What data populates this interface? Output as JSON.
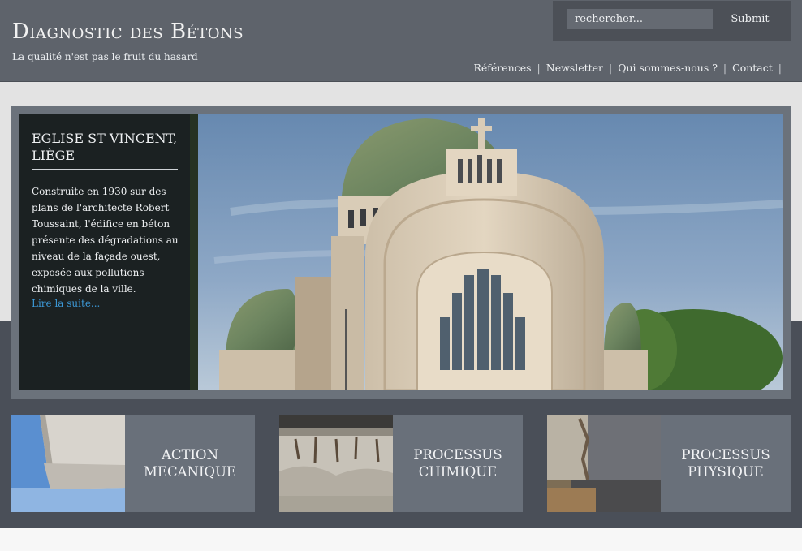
{
  "header": {
    "site_title": "Diagnostic des Bétons",
    "tagline": "La qualité n'est pas le fruit du hasard"
  },
  "search": {
    "placeholder": "rechercher...",
    "submit_label": "Submit"
  },
  "nav": {
    "items": [
      {
        "label": "Références"
      },
      {
        "label": "Newsletter"
      },
      {
        "label": "Qui sommes-nous ?"
      },
      {
        "label": "Contact"
      }
    ],
    "separator": "|"
  },
  "slider": {
    "title": "EGLISE ST VINCENT, LIÈGE",
    "text": "Construite en 1930 sur des plans de l'architecte Robert Toussaint, l'édifice en béton présente des dégradations au niveau de la façade ouest, exposée aux pollutions chimiques de la ville.",
    "link": "Lire la suite..."
  },
  "features": [
    {
      "label": "ACTION MECANIQUE"
    },
    {
      "label": "PROCESSUS CHIMIQUE"
    },
    {
      "label": "PROCESSUS PHYSIQUE"
    }
  ],
  "colors": {
    "header_bg": "#5e636b",
    "band_bg": "#4a4f58",
    "link_blue": "#3c98d6",
    "feature_bg": "#69707a"
  }
}
